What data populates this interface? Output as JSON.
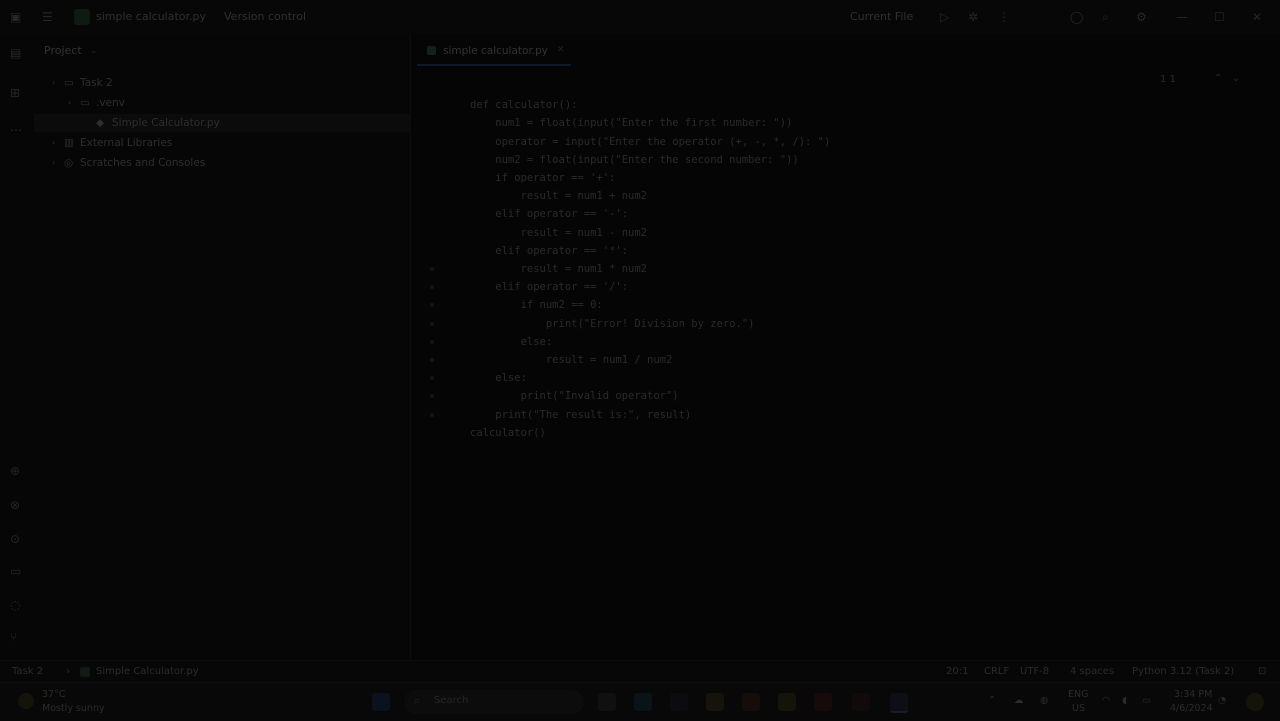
{
  "titlebar": {
    "project_name": "simple calculator.py",
    "vcs": "Version control",
    "run_config": "Current File"
  },
  "project_panel": {
    "title": "Project",
    "tree": [
      {
        "label": "Task 2",
        "indent": 0,
        "icon": "folder-icon"
      },
      {
        "label": ".venv",
        "indent": 1,
        "icon": "folder-icon"
      },
      {
        "label": "Simple Calculator.py",
        "indent": 2,
        "icon": "python-file-icon"
      },
      {
        "label": "External Libraries",
        "indent": 0,
        "icon": "library-icon"
      },
      {
        "label": "Scratches and Consoles",
        "indent": 0,
        "icon": "scratch-icon"
      }
    ]
  },
  "editor": {
    "tab_label": "simple calculator.py",
    "inspection": "1  1",
    "code": [
      "",
      "def calculator():",
      "    num1 = float(input(\"Enter the first number: \"))",
      "    operator = input(\"Enter the operator (+, -, *, /): \")",
      "    num2 = float(input(\"Enter the second number: \"))",
      "    if operator == '+':",
      "        result = num1 + num2",
      "    elif operator == '-':",
      "        result = num1 - num2",
      "    elif operator == '*':",
      "        result = num1 * num2",
      "    elif operator == '/':",
      "        if num2 == 0:",
      "            print(\"Error! Division by zero.\")",
      "        else:",
      "            result = num1 / num2",
      "    else:",
      "        print(\"Invalid operator\")",
      "    print(\"The result is:\", result)",
      "calculator()"
    ]
  },
  "statusbar": {
    "breadcrumb_root": "Task 2",
    "breadcrumb_file": "Simple Calculator.py",
    "position": "20:1",
    "line_sep": "CRLF",
    "encoding": "UTF-8",
    "indent": "4 spaces",
    "interpreter": "Python 3.12 (Task 2)"
  },
  "taskbar": {
    "weather_temp": "37°C",
    "weather_desc": "Mostly sunny",
    "search_placeholder": "Search",
    "lang": "ENG",
    "region": "US",
    "time": "3:34 PM",
    "date": "4/6/2024"
  },
  "colors": {
    "background": "#050505",
    "taskbar": "#080808"
  }
}
